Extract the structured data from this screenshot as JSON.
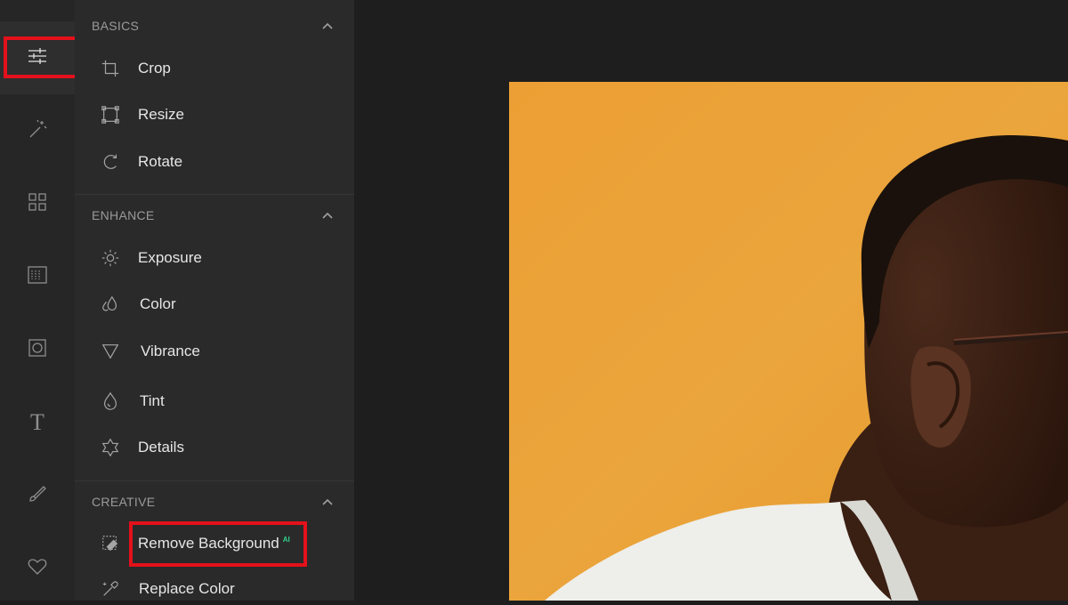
{
  "rail": {
    "items": [
      {
        "name": "adjust",
        "icon": "sliders-icon",
        "active": true
      },
      {
        "name": "effects",
        "icon": "magic-wand-icon",
        "active": false
      },
      {
        "name": "templates",
        "icon": "grid-icon",
        "active": false
      },
      {
        "name": "overlays",
        "icon": "texture-icon",
        "active": false
      },
      {
        "name": "frames",
        "icon": "frame-icon",
        "active": false
      },
      {
        "name": "text",
        "icon": "text-icon",
        "glyph": "T",
        "active": false
      },
      {
        "name": "draw",
        "icon": "brush-icon",
        "active": false
      },
      {
        "name": "favorites",
        "icon": "heart-icon",
        "active": false
      }
    ]
  },
  "panel": {
    "basics": {
      "title": "BASICS",
      "tools": [
        {
          "label": "Crop",
          "icon": "crop-icon"
        },
        {
          "label": "Resize",
          "icon": "resize-icon"
        },
        {
          "label": "Rotate",
          "icon": "rotate-icon"
        }
      ]
    },
    "enhance": {
      "title": "ENHANCE",
      "tools": [
        {
          "label": "Exposure",
          "icon": "sun-icon"
        },
        {
          "label": "Color",
          "icon": "drops-icon"
        },
        {
          "label": "Vibrance",
          "icon": "triangle-icon"
        },
        {
          "label": "Tint",
          "icon": "drop-icon"
        },
        {
          "label": "Details",
          "icon": "details-icon"
        }
      ]
    },
    "creative": {
      "title": "CREATIVE",
      "tools": [
        {
          "label": "Remove Background",
          "badge": "AI",
          "icon": "remove-background-icon"
        },
        {
          "label": "Replace Color",
          "icon": "color-replace-icon"
        }
      ]
    }
  },
  "colors": {
    "highlight": "#e3111b",
    "ai_badge": "#2fd18b",
    "photo_background": "#e9a23b"
  }
}
